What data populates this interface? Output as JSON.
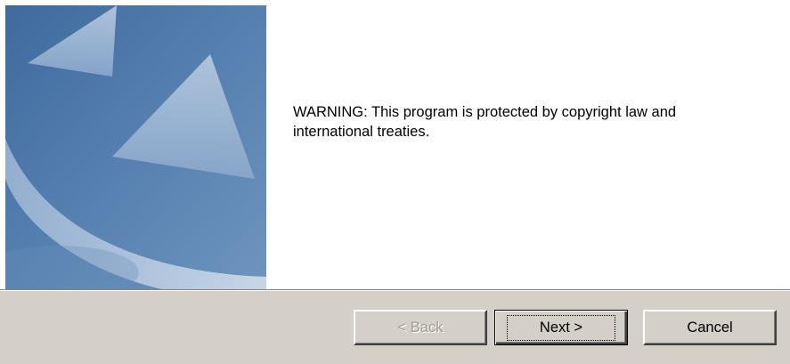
{
  "message": {
    "line1": "WARNING: This program is protected by copyright law and",
    "line2": "international treaties."
  },
  "buttons": {
    "back_label": "< Back",
    "next_label": "Next >",
    "cancel_label": "Cancel"
  },
  "colors": {
    "banner_blue": "#4f78a8",
    "dialog_gray": "#d4d0c8",
    "content_white": "#ffffff"
  }
}
